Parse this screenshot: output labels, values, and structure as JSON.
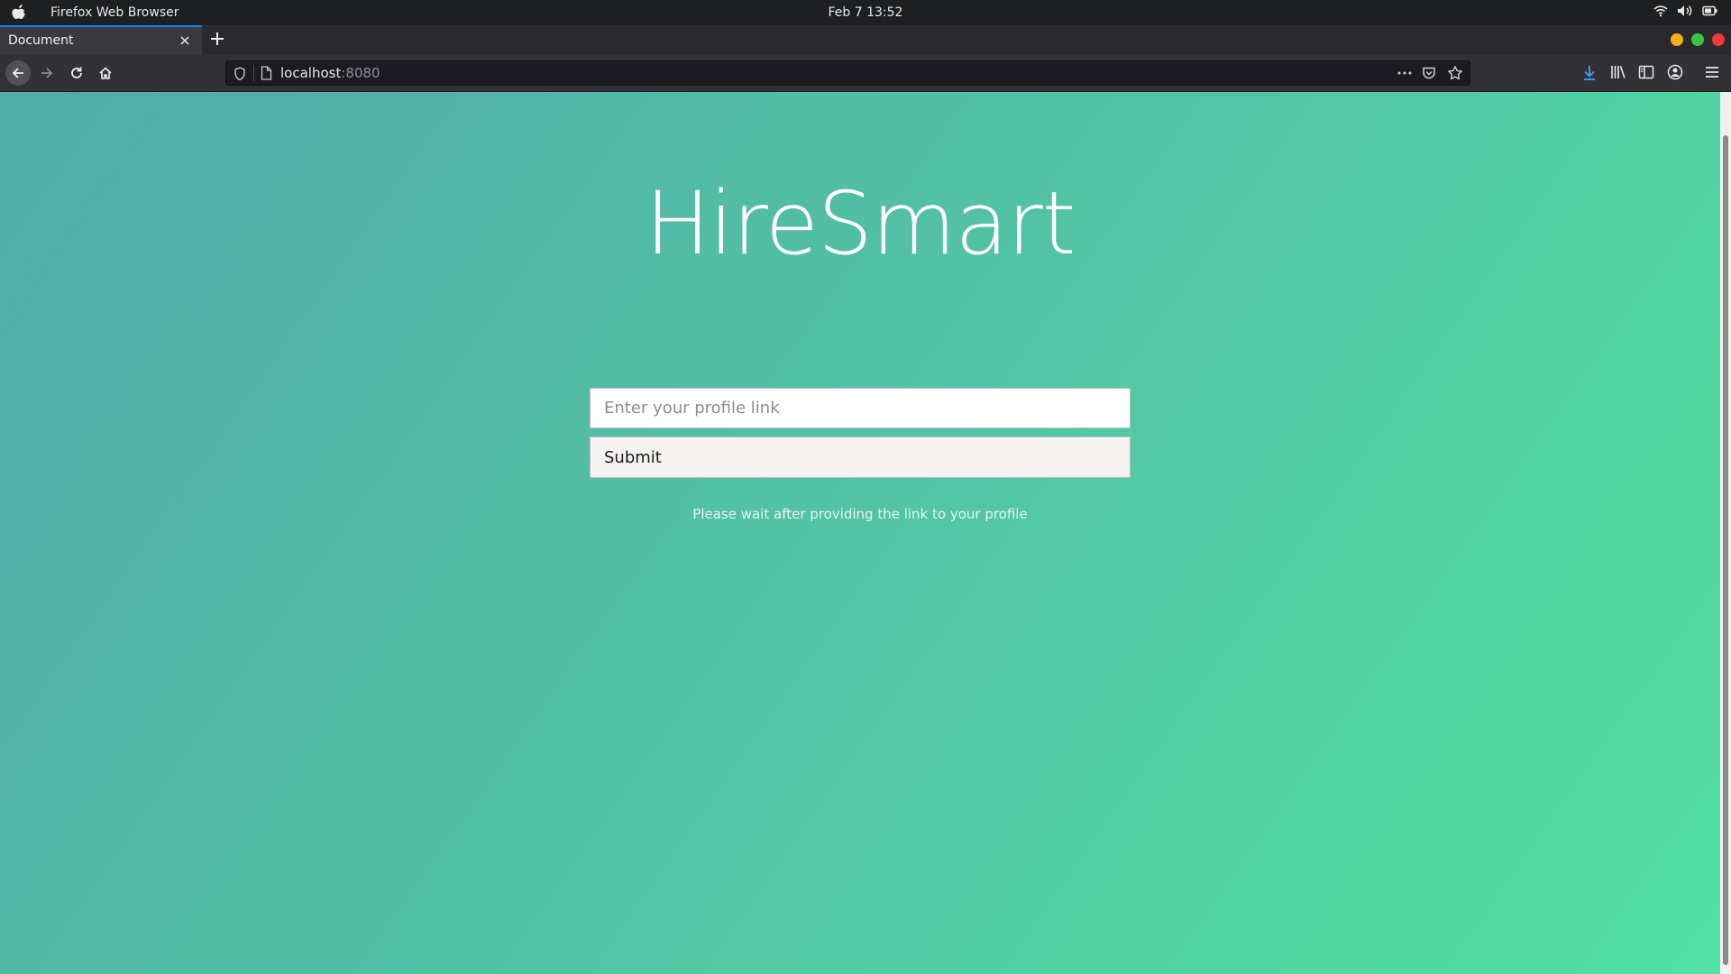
{
  "os_bar": {
    "app_name": "Firefox Web Browser",
    "clock": "Feb 7  13:52"
  },
  "browser": {
    "tab_title": "Document",
    "url_host": "localhost",
    "url_port": ":8080",
    "accent_color": "#0a84ff"
  },
  "page": {
    "title": "HireSmart",
    "input_placeholder": "Enter your profile link",
    "submit_label": "Submit",
    "hint": "Please wait after providing the link to your profile",
    "gradient_colors": [
      "#51aba8",
      "#52e0a3"
    ]
  }
}
